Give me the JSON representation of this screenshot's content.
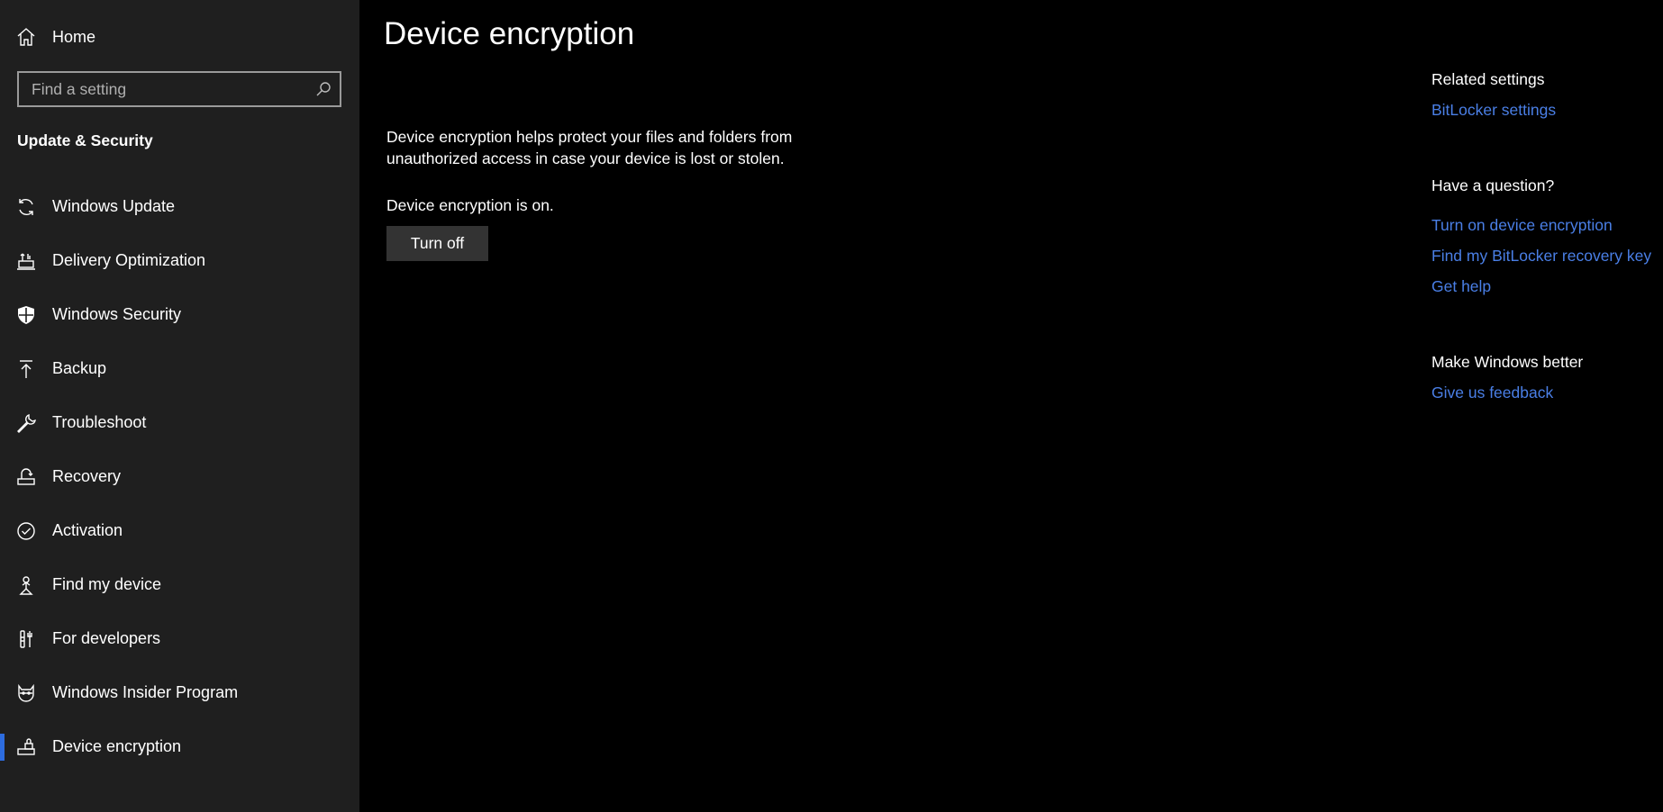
{
  "sidebar": {
    "home_label": "Home",
    "search_placeholder": "Find a setting",
    "section_title": "Update & Security",
    "items": [
      {
        "label": "Windows Update",
        "icon": "refresh-icon"
      },
      {
        "label": "Delivery Optimization",
        "icon": "delivery-icon"
      },
      {
        "label": "Windows Security",
        "icon": "shield-icon"
      },
      {
        "label": "Backup",
        "icon": "backup-arrow-icon"
      },
      {
        "label": "Troubleshoot",
        "icon": "wrench-icon"
      },
      {
        "label": "Recovery",
        "icon": "recovery-icon"
      },
      {
        "label": "Activation",
        "icon": "check-circle-icon"
      },
      {
        "label": "Find my device",
        "icon": "person-pin-icon"
      },
      {
        "label": "For developers",
        "icon": "developer-tools-icon"
      },
      {
        "label": "Windows Insider Program",
        "icon": "ninja-cat-icon"
      },
      {
        "label": "Device encryption",
        "icon": "encryption-icon"
      }
    ],
    "active_index": 10
  },
  "main": {
    "title": "Device encryption",
    "description": "Device encryption helps protect your files and folders from unauthorized access in case your device is lost or stolen.",
    "status": "Device encryption is on.",
    "button_label": "Turn off"
  },
  "right": {
    "related_heading": "Related settings",
    "bitlocker_link": "BitLocker settings",
    "question_heading": "Have a question?",
    "question_links": [
      "Turn on device encryption",
      "Find my BitLocker recovery key",
      "Get help"
    ],
    "better_heading": "Make Windows better",
    "feedback_link": "Give us feedback"
  },
  "colors": {
    "accent": "#2d6cdf",
    "link": "#4a7fe6",
    "sidebar_bg": "#1f1f1f",
    "main_bg": "#000000",
    "button_bg": "#333333"
  }
}
